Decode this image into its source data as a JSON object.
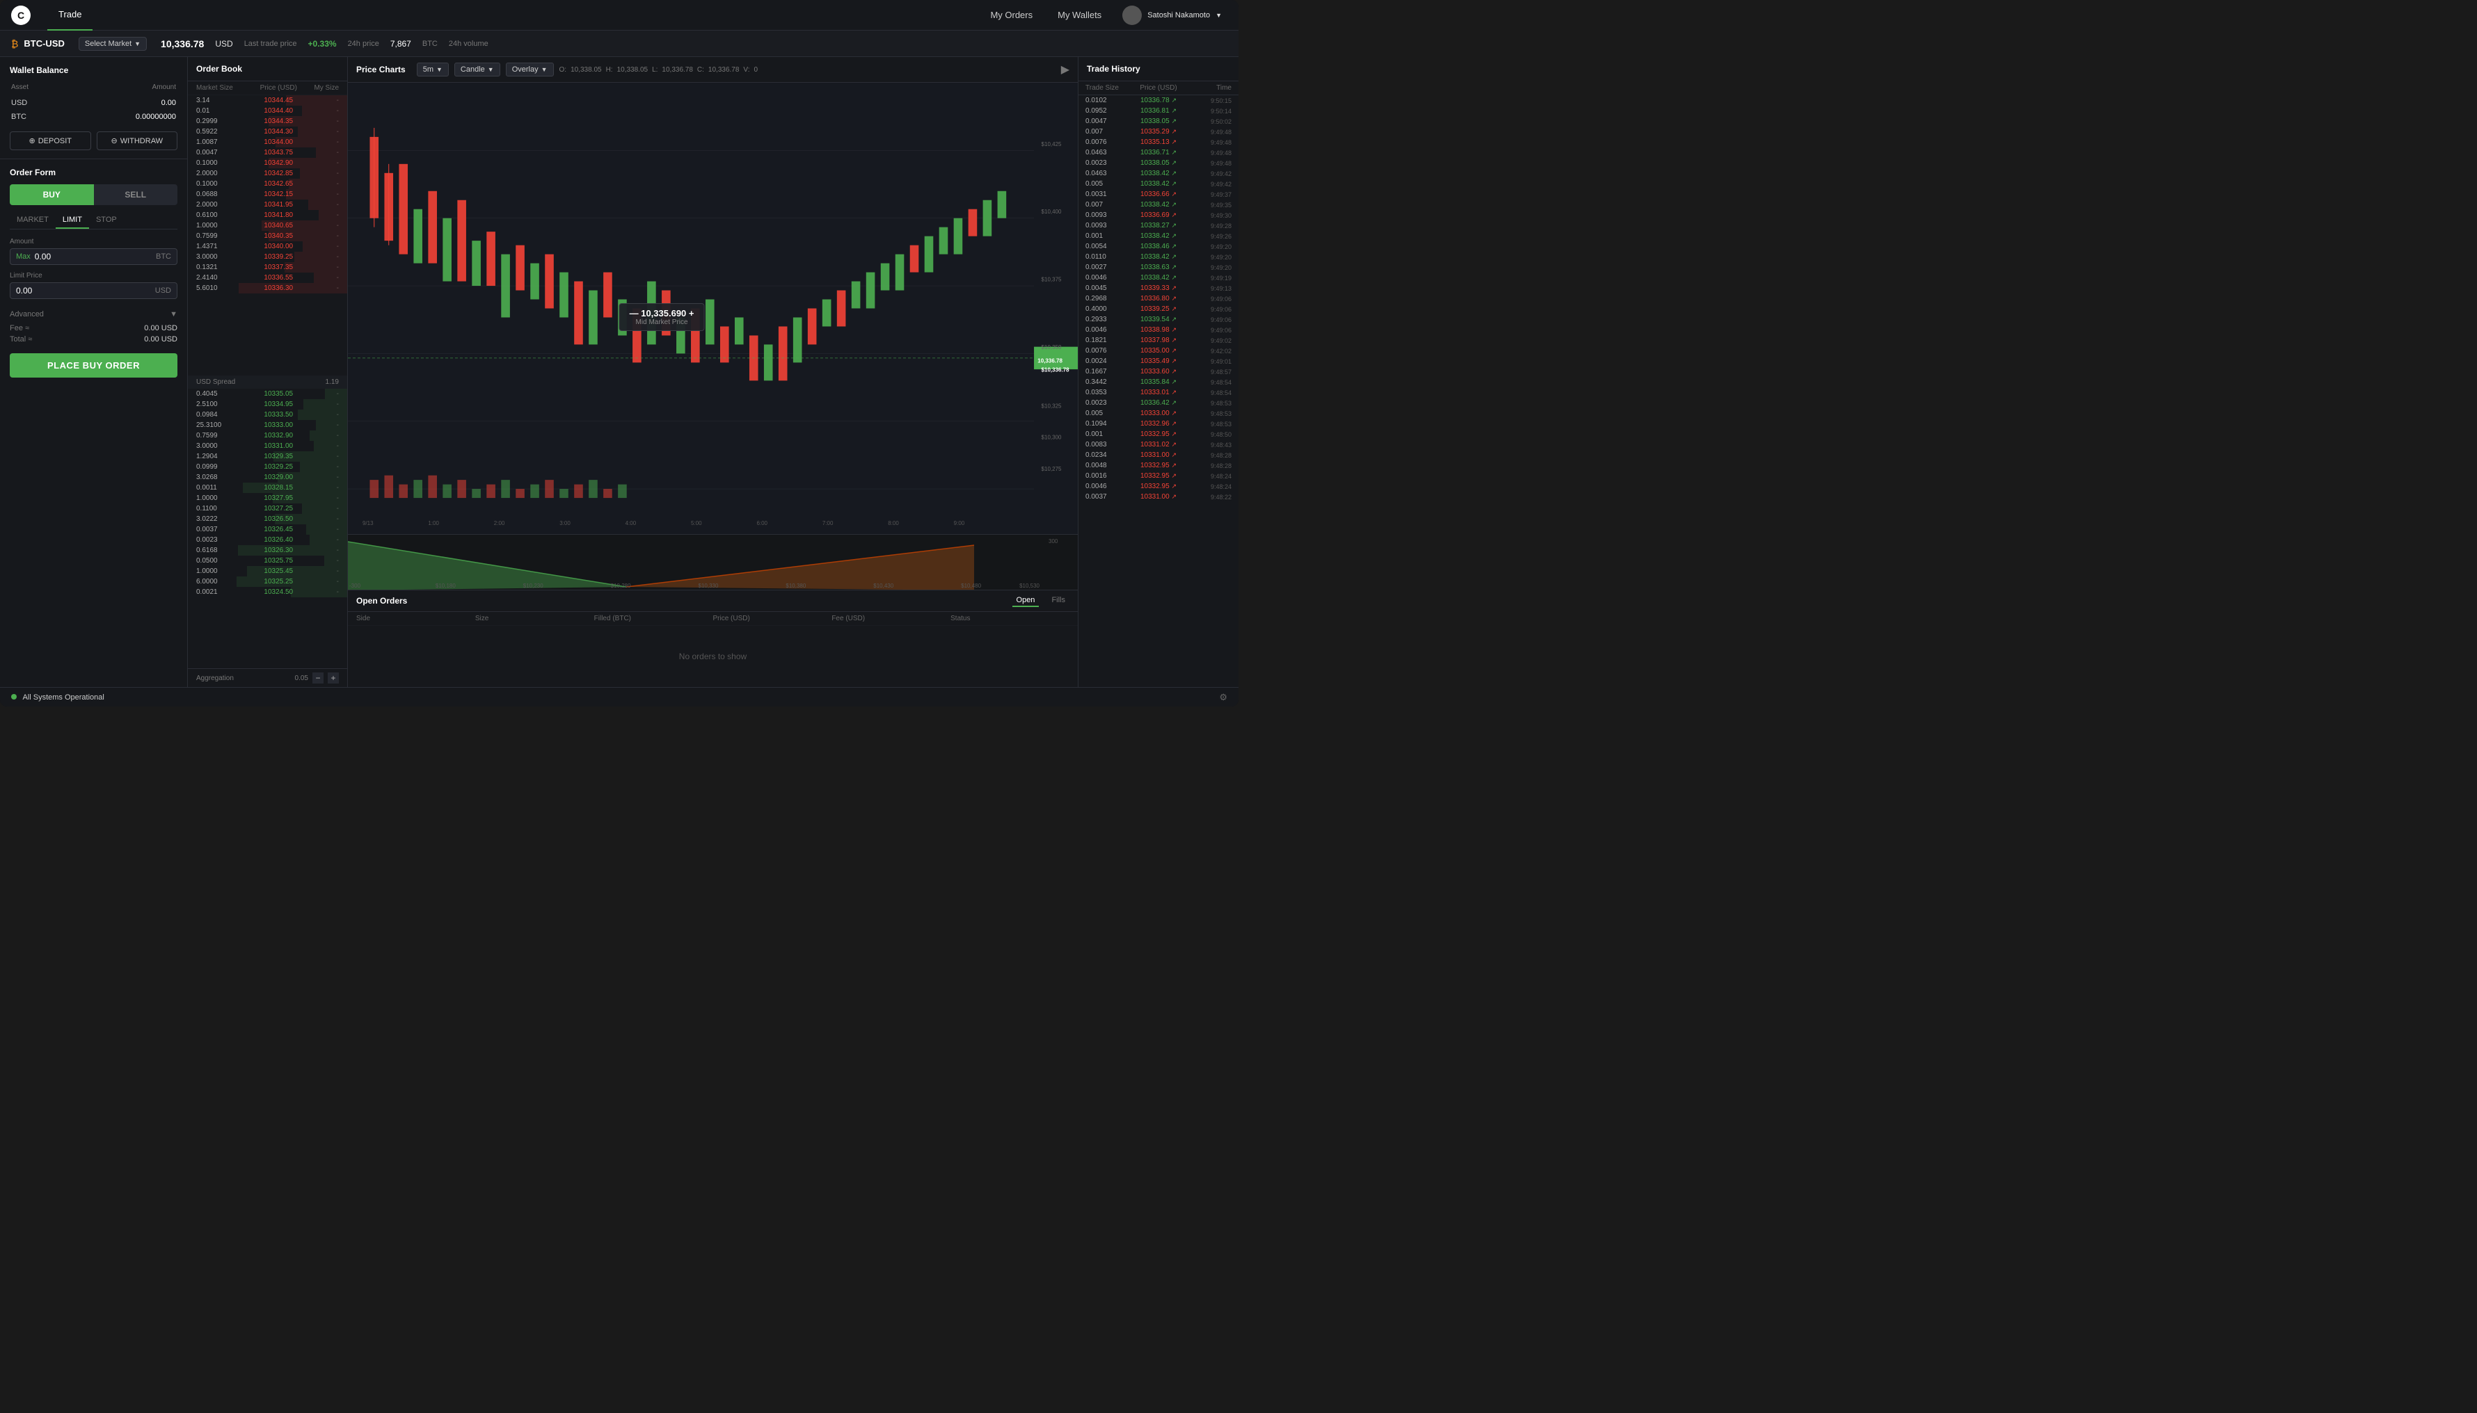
{
  "app": {
    "logo": "C",
    "nav_tabs": [
      "Trade"
    ],
    "active_tab": "Trade",
    "nav_right": {
      "my_orders": "My Orders",
      "my_wallets": "My Wallets",
      "user_name": "Satoshi Nakamoto"
    }
  },
  "sub_header": {
    "pair": "BTC-USD",
    "select_market": "Select Market",
    "last_price": "10,336.78",
    "currency": "USD",
    "price_label": "Last trade price",
    "change": "+0.33%",
    "change_label": "24h price",
    "volume": "7,867",
    "volume_currency": "BTC",
    "volume_label": "24h volume"
  },
  "wallet_balance": {
    "title": "Wallet Balance",
    "col_asset": "Asset",
    "col_amount": "Amount",
    "usd_asset": "USD",
    "usd_amount": "0.00",
    "btc_asset": "BTC",
    "btc_amount": "0.00000000",
    "deposit_btn": "DEPOSIT",
    "withdraw_btn": "WITHDRAW"
  },
  "order_form": {
    "title": "Order Form",
    "buy_label": "BUY",
    "sell_label": "SELL",
    "types": [
      "MARKET",
      "LIMIT",
      "STOP"
    ],
    "active_type": "LIMIT",
    "amount_label": "Amount",
    "amount_max": "Max",
    "amount_value": "0.00",
    "amount_currency": "BTC",
    "limit_price_label": "Limit Price",
    "limit_price_value": "0.00",
    "limit_price_currency": "USD",
    "advanced_label": "Advanced",
    "fee_label": "Fee ≈",
    "fee_value": "0.00 USD",
    "total_label": "Total ≈",
    "total_value": "0.00 USD",
    "place_order_btn": "PLACE BUY ORDER"
  },
  "order_book": {
    "title": "Order Book",
    "col_market_size": "Market Size",
    "col_price": "Price (USD)",
    "col_my_size": "My Size",
    "asks": [
      {
        "size": "3.14",
        "price": "10344.45",
        "my": "-"
      },
      {
        "size": "0.01",
        "price": "10344.40",
        "my": "-"
      },
      {
        "size": "0.2999",
        "price": "10344.35",
        "my": "-"
      },
      {
        "size": "0.5922",
        "price": "10344.30",
        "my": "-"
      },
      {
        "size": "1.0087",
        "price": "10344.00",
        "my": "-"
      },
      {
        "size": "0.0047",
        "price": "10343.75",
        "my": "-"
      },
      {
        "size": "0.1000",
        "price": "10342.90",
        "my": "-"
      },
      {
        "size": "2.0000",
        "price": "10342.85",
        "my": "-"
      },
      {
        "size": "0.1000",
        "price": "10342.65",
        "my": "-"
      },
      {
        "size": "0.0688",
        "price": "10342.15",
        "my": "-"
      },
      {
        "size": "2.0000",
        "price": "10341.95",
        "my": "-"
      },
      {
        "size": "0.6100",
        "price": "10341.80",
        "my": "-"
      },
      {
        "size": "1.0000",
        "price": "10340.65",
        "my": "-"
      },
      {
        "size": "0.7599",
        "price": "10340.35",
        "my": "-"
      },
      {
        "size": "1.4371",
        "price": "10340.00",
        "my": "-"
      },
      {
        "size": "3.0000",
        "price": "10339.25",
        "my": "-"
      },
      {
        "size": "0.1321",
        "price": "10337.35",
        "my": "-"
      },
      {
        "size": "2.4140",
        "price": "10336.55",
        "my": "-"
      },
      {
        "size": "5.6010",
        "price": "10336.30",
        "my": "-"
      }
    ],
    "spread_label": "USD Spread",
    "spread_value": "1.19",
    "bids": [
      {
        "size": "0.4045",
        "price": "10335.05",
        "my": "-"
      },
      {
        "size": "2.5100",
        "price": "10334.95",
        "my": "-"
      },
      {
        "size": "0.0984",
        "price": "10333.50",
        "my": "-"
      },
      {
        "size": "25.3100",
        "price": "10333.00",
        "my": "-"
      },
      {
        "size": "0.7599",
        "price": "10332.90",
        "my": "-"
      },
      {
        "size": "3.0000",
        "price": "10331.00",
        "my": "-"
      },
      {
        "size": "1.2904",
        "price": "10329.35",
        "my": "-"
      },
      {
        "size": "0.0999",
        "price": "10329.25",
        "my": "-"
      },
      {
        "size": "3.0268",
        "price": "10329.00",
        "my": "-"
      },
      {
        "size": "0.0011",
        "price": "10328.15",
        "my": "-"
      },
      {
        "size": "1.0000",
        "price": "10327.95",
        "my": "-"
      },
      {
        "size": "0.1100",
        "price": "10327.25",
        "my": "-"
      },
      {
        "size": "3.0222",
        "price": "10326.50",
        "my": "-"
      },
      {
        "size": "0.0037",
        "price": "10326.45",
        "my": "-"
      },
      {
        "size": "0.0023",
        "price": "10326.40",
        "my": "-"
      },
      {
        "size": "0.6168",
        "price": "10326.30",
        "my": "-"
      },
      {
        "size": "0.0500",
        "price": "10325.75",
        "my": "-"
      },
      {
        "size": "1.0000",
        "price": "10325.45",
        "my": "-"
      },
      {
        "size": "6.0000",
        "price": "10325.25",
        "my": "-"
      },
      {
        "size": "0.0021",
        "price": "10324.50",
        "my": "-"
      }
    ],
    "aggregation_label": "Aggregation",
    "aggregation_value": "0.05"
  },
  "price_charts": {
    "title": "Price Charts",
    "timeframe": "5m",
    "chart_type": "Candle",
    "overlay": "Overlay",
    "ohlcv": {
      "o": "10,338.05",
      "h": "10,338.05",
      "l": "10,336.78",
      "c": "10,336.78",
      "v": "0"
    },
    "price_levels": [
      "$10,425",
      "$10,400",
      "$10,375",
      "$10,350",
      "$10,325",
      "$10,300",
      "$10,275"
    ],
    "current_price": "10,336.78",
    "time_labels": [
      "9/13",
      "1:00",
      "2:00",
      "3:00",
      "4:00",
      "5:00",
      "6:00",
      "7:00",
      "8:00",
      "9:00",
      "1("
    ],
    "mid_market_price": "10,335.690",
    "mid_market_label": "Mid Market Price",
    "depth_labels": [
      "-300",
      "$10,180",
      "$10,230",
      "$10,280",
      "$10,330",
      "$10,380",
      "$10,430",
      "$10,480",
      "$10,530",
      "300"
    ]
  },
  "open_orders": {
    "title": "Open Orders",
    "tabs": [
      "Open",
      "Fills"
    ],
    "active_tab": "Open",
    "cols": [
      "Side",
      "Size",
      "Filled (BTC)",
      "Price (USD)",
      "Fee (USD)",
      "Status"
    ],
    "empty_message": "No orders to show"
  },
  "trade_history": {
    "title": "Trade History",
    "col_trade_size": "Trade Size",
    "col_price": "Price (USD)",
    "col_time": "Time",
    "rows": [
      {
        "size": "0.0102",
        "price": "10336.78",
        "dir": "up",
        "time": "9:50:15"
      },
      {
        "size": "0.0952",
        "price": "10336.81",
        "dir": "up",
        "time": "9:50:14"
      },
      {
        "size": "0.0047",
        "price": "10338.05",
        "dir": "up",
        "time": "9:50:02"
      },
      {
        "size": "0.007",
        "price": "10335.29",
        "dir": "dn",
        "time": "9:49:48"
      },
      {
        "size": "0.0076",
        "price": "10335.13",
        "dir": "dn",
        "time": "9:49:48"
      },
      {
        "size": "0.0463",
        "price": "10336.71",
        "dir": "up",
        "time": "9:49:48"
      },
      {
        "size": "0.0023",
        "price": "10338.05",
        "dir": "up",
        "time": "9:49:48"
      },
      {
        "size": "0.0463",
        "price": "10338.42",
        "dir": "up",
        "time": "9:49:42"
      },
      {
        "size": "0.005",
        "price": "10338.42",
        "dir": "up",
        "time": "9:49:42"
      },
      {
        "size": "0.0031",
        "price": "10336.66",
        "dir": "dn",
        "time": "9:49:37"
      },
      {
        "size": "0.007",
        "price": "10338.42",
        "dir": "up",
        "time": "9:49:35"
      },
      {
        "size": "0.0093",
        "price": "10336.69",
        "dir": "dn",
        "time": "9:49:30"
      },
      {
        "size": "0.0093",
        "price": "10338.27",
        "dir": "up",
        "time": "9:49:28"
      },
      {
        "size": "0.001",
        "price": "10338.42",
        "dir": "up",
        "time": "9:49:26"
      },
      {
        "size": "0.0054",
        "price": "10338.46",
        "dir": "up",
        "time": "9:49:20"
      },
      {
        "size": "0.0110",
        "price": "10338.42",
        "dir": "up",
        "time": "9:49:20"
      },
      {
        "size": "0.0027",
        "price": "10338.63",
        "dir": "up",
        "time": "9:49:20"
      },
      {
        "size": "0.0046",
        "price": "10338.42",
        "dir": "up",
        "time": "9:49:19"
      },
      {
        "size": "0.0045",
        "price": "10339.33",
        "dir": "dn",
        "time": "9:49:13"
      },
      {
        "size": "0.2968",
        "price": "10336.80",
        "dir": "dn",
        "time": "9:49:06"
      },
      {
        "size": "0.4000",
        "price": "10339.25",
        "dir": "dn",
        "time": "9:49:06"
      },
      {
        "size": "0.2933",
        "price": "10339.54",
        "dir": "up",
        "time": "9:49:06"
      },
      {
        "size": "0.0046",
        "price": "10338.98",
        "dir": "dn",
        "time": "9:49:06"
      },
      {
        "size": "0.1821",
        "price": "10337.98",
        "dir": "dn",
        "time": "9:49:02"
      },
      {
        "size": "0.0076",
        "price": "10335.00",
        "dir": "dn",
        "time": "9:42:02"
      },
      {
        "size": "0.0024",
        "price": "10335.49",
        "dir": "dn",
        "time": "9:49:01"
      },
      {
        "size": "0.1667",
        "price": "10333.60",
        "dir": "dn",
        "time": "9:48:57"
      },
      {
        "size": "0.3442",
        "price": "10335.84",
        "dir": "up",
        "time": "9:48:54"
      },
      {
        "size": "0.0353",
        "price": "10333.01",
        "dir": "dn",
        "time": "9:48:54"
      },
      {
        "size": "0.0023",
        "price": "10336.42",
        "dir": "up",
        "time": "9:48:53"
      },
      {
        "size": "0.005",
        "price": "10333.00",
        "dir": "dn",
        "time": "9:48:53"
      },
      {
        "size": "0.1094",
        "price": "10332.96",
        "dir": "dn",
        "time": "9:48:53"
      },
      {
        "size": "0.001",
        "price": "10332.95",
        "dir": "dn",
        "time": "9:48:50"
      },
      {
        "size": "0.0083",
        "price": "10331.02",
        "dir": "dn",
        "time": "9:48:43"
      },
      {
        "size": "0.0234",
        "price": "10331.00",
        "dir": "dn",
        "time": "9:48:28"
      },
      {
        "size": "0.0048",
        "price": "10332.95",
        "dir": "dn",
        "time": "9:48:28"
      },
      {
        "size": "0.0016",
        "price": "10332.95",
        "dir": "dn",
        "time": "9:48:24"
      },
      {
        "size": "0.0046",
        "price": "10332.95",
        "dir": "dn",
        "time": "9:48:24"
      },
      {
        "size": "0.0037",
        "price": "10331.00",
        "dir": "dn",
        "time": "9:48:22"
      }
    ]
  },
  "bottom_bar": {
    "status_text": "All Systems Operational"
  }
}
